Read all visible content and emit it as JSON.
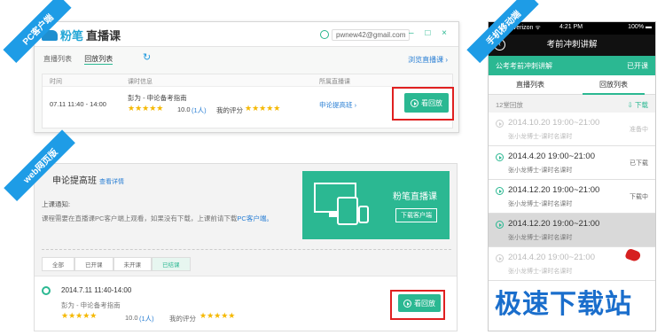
{
  "ribbons": {
    "pc": "PC客户端",
    "web": "web网页版",
    "mobile": "手机移动端"
  },
  "pc": {
    "logo": "粉笔",
    "app_title": "直播课",
    "user": "pwnew42@gmail.com",
    "win_buttons": "– □ ×",
    "tabs": [
      "直播列表",
      "回放列表"
    ],
    "browse_link": "浏览直播课 ›",
    "headers": {
      "time": "时间",
      "info": "课时信息",
      "course": "所属直播课"
    },
    "row": {
      "time": "07.11 11:40 - 14:00",
      "title": "彭为 - 申论备考指南",
      "stars": "★★★★★",
      "score": "10.0",
      "count": "(1人)",
      "my_label": "我的评分",
      "my_stars": "★★★★★",
      "course": "申论提高班 ›",
      "btn": "看回放"
    }
  },
  "web": {
    "title": "申论提高班",
    "detail": "查看详情",
    "notice_title": "上课通知:",
    "notice": "课程需要在直播课PC客户端上观看，如果没有下载，上课前请下载",
    "notice_link": "PC客户端。",
    "banner_title": "粉笔直播课",
    "banner_btn": "下载客户端",
    "tabs": [
      "全部",
      "已开课",
      "未开课",
      "已结课"
    ],
    "item": {
      "time": "2014.7.11 11:40-14:00",
      "title": "彭为 - 申论备考指南",
      "stars": "★★★★★",
      "score": "10.0",
      "count": "(1人)",
      "my_label": "我的评分",
      "my_stars": "★★★★★",
      "btn": "看回放"
    }
  },
  "mobile": {
    "carrier": "●●●○○ Verizon ᯤ",
    "clock": "4:21 PM",
    "battery": "100% ▬",
    "back": "‹",
    "nav_title": "考前冲刺讲解",
    "course": "公考考前冲刺讲解",
    "course_status": "已开课",
    "tabs": [
      "直播列表",
      "回放列表"
    ],
    "count": "12堂回放",
    "download": "⇩ 下载",
    "items": [
      {
        "time": "2014.10.20  19:00~21:00",
        "sub": "张小龙博士-课时名课时",
        "status": "准备中"
      },
      {
        "time": "2014.4.20  19:00~21:00",
        "sub": "张小龙博士-课时名课时",
        "status": "已下载"
      },
      {
        "time": "2014.12.20  19:00~21:00",
        "sub": "张小龙博士-课时名课时",
        "status": "下载中"
      },
      {
        "time": "2014.12.20  19:00~21:00",
        "sub": "张小龙博士-课时名课时",
        "status": ""
      },
      {
        "time": "2014.4.20  19:00~21:00",
        "sub": "张小龙博士-课时名课时",
        "status": ""
      }
    ]
  },
  "watermark": "极速下载站"
}
